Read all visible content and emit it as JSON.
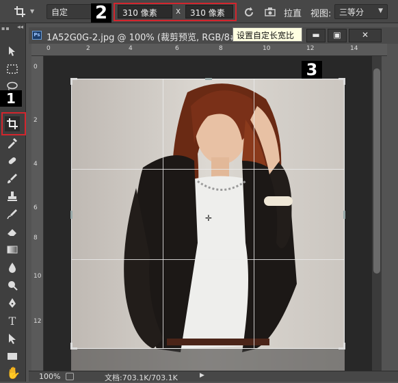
{
  "options_bar": {
    "preset": "自定",
    "width_value": "310 像素",
    "height_value": "310 像素",
    "separator": "x",
    "straighten_label": "拉直",
    "view_label": "视图:",
    "view_value": "三等分"
  },
  "tooltip": "设置自定长宽比",
  "markers": {
    "one": "1",
    "two": "2",
    "three": "3"
  },
  "document": {
    "ps_badge": "Ps",
    "title": "1A52G0G-2.jpg @ 100% (裁剪预览, RGB/8#)"
  },
  "ruler_h": [
    "0",
    "2",
    "4",
    "6",
    "8",
    "10",
    "12",
    "14"
  ],
  "ruler_v": [
    "0",
    "2",
    "4",
    "6",
    "8",
    "10",
    "12"
  ],
  "status": {
    "zoom": "100%",
    "doc_size": "文档:703.1K/703.1K"
  },
  "icons": {
    "crop": "crop-icon",
    "move": "move-icon",
    "marquee": "marquee-icon",
    "lasso": "lasso-icon",
    "eyedropper": "eyedropper-icon",
    "healing": "healing-brush-icon",
    "brush": "brush-icon",
    "stamp": "clone-stamp-icon",
    "history": "history-brush-icon",
    "eraser": "eraser-icon",
    "gradient": "gradient-icon",
    "blur": "blur-icon",
    "dodge": "dodge-icon",
    "pen": "pen-icon",
    "type": "type-icon",
    "path": "path-selection-icon",
    "shape": "rectangle-shape-icon",
    "hand": "hand-icon"
  },
  "colors": {
    "highlight": "#d4252d",
    "tooltip_bg": "#ffffe1",
    "badge_bg": "#000000"
  }
}
